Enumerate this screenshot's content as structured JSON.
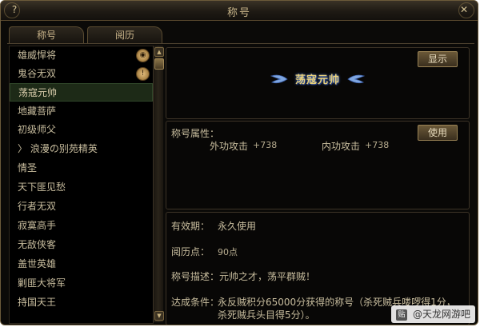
{
  "window": {
    "title": "称号",
    "help_icon": "?",
    "close_icon": "✕"
  },
  "tabs": [
    {
      "label": "称号"
    },
    {
      "label": "阅历"
    }
  ],
  "title_list": [
    {
      "label": "雄威悍将",
      "badge": "eye-icon"
    },
    {
      "label": "鬼谷无双",
      "badge": "exclamation-icon"
    },
    {
      "label": "荡寇元帅",
      "selected": true
    },
    {
      "label": "地藏菩萨"
    },
    {
      "label": "初级师父"
    },
    {
      "label": "〉 浪漫の别苑精英"
    },
    {
      "label": "情圣"
    },
    {
      "label": "天下匪见愁"
    },
    {
      "label": "行者无双"
    },
    {
      "label": "寂寞高手"
    },
    {
      "label": "无敌侠客"
    },
    {
      "label": "盖世英雄"
    },
    {
      "label": "剿匪大将军"
    },
    {
      "label": "持国天王"
    },
    {
      "label": "…"
    }
  ],
  "display": {
    "show_label": "显示",
    "selected_title": "荡寇元帅"
  },
  "attributes": {
    "title": "称号属性：",
    "outer_label": "外功攻击",
    "outer_value": "+738",
    "inner_label": "内功攻击",
    "inner_value": "+738",
    "use_label": "使用"
  },
  "details": {
    "validity_label": "有效期：",
    "validity_value": "永久使用",
    "points_label": "阅历点：",
    "points_value": "90点",
    "desc_label": "称号描述：元帅之才，荡平群贼！",
    "cond_label": "达成条件：",
    "cond_line1": "永反贼积分65000分获得的称号（杀死贼兵喽啰得1分，",
    "cond_line2": "杀死贼兵头目得5分）。"
  },
  "watermark": {
    "logo": "贴",
    "text": "@天龙网游吧"
  },
  "colors": {
    "gold_text": "#c9b68a",
    "emblem": "#ecd27a",
    "selected_row": "#1d2a17",
    "border": "#5b4a2e"
  }
}
